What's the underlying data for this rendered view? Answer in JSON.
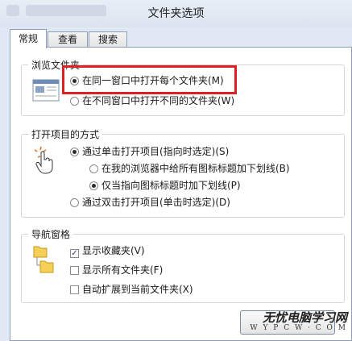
{
  "window": {
    "title": "文件夹选项"
  },
  "tabs": [
    {
      "label": "常规"
    },
    {
      "label": "查看"
    },
    {
      "label": "搜索"
    }
  ],
  "browse_folders": {
    "legend": "浏览文件夹",
    "options": [
      {
        "label": "在同一窗口中打开每个文件夹(M)",
        "selected": true
      },
      {
        "label": "在不同窗口中打开不同的文件夹(W)",
        "selected": false
      }
    ]
  },
  "click_items": {
    "legend": "打开项目的方式",
    "single_click": {
      "label": "通过单击打开项目(指向时选定)(S)",
      "selected": true
    },
    "underline_consistent": {
      "label": "在我的浏览器中给所有图标标题加下划线(B)",
      "selected": false
    },
    "underline_point": {
      "label": "仅当指向图标标题时加下划线(P)",
      "selected": true
    },
    "double_click": {
      "label": "通过双击打开项目(单击时选定)(D)",
      "selected": false
    }
  },
  "nav_pane": {
    "legend": "导航窗格",
    "show_favorites": {
      "label": "显示收藏夹(V)",
      "checked": true
    },
    "show_all_folders": {
      "label": "显示所有文件夹(F)",
      "checked": false
    },
    "auto_expand": {
      "label": "自动扩展到当前文件夹(X)",
      "checked": false
    }
  },
  "watermark": {
    "line1": "无忧电脑学习网",
    "line2": "W Y P C W · C O M"
  },
  "colors": {
    "highlight": "#e02020",
    "window_bg": "#dfe8f3"
  }
}
